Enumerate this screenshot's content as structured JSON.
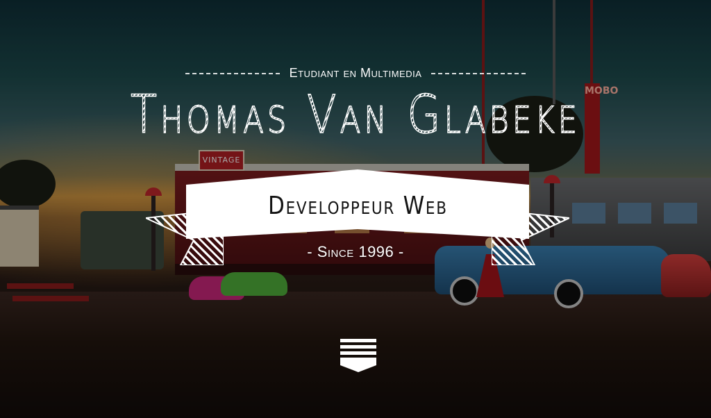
{
  "hero": {
    "subtitle": "Etudiant en Multimedia",
    "name": "Thomas Van Glabeke",
    "role": "Developpeur Web",
    "since": "- Since 1996 -"
  },
  "scenery": {
    "diner_sign": "VINTAGE",
    "tower_sign": "MOBO"
  },
  "scroll": {
    "icon": "chevrons-down-icon"
  },
  "colors": {
    "text": "#ffffff",
    "banner_bg": "#ffffff",
    "banner_text": "#141414"
  }
}
